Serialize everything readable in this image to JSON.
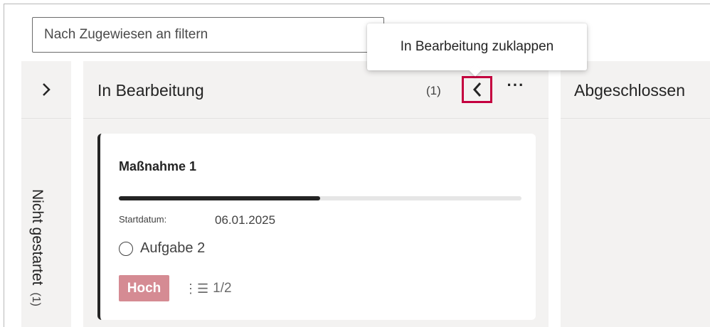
{
  "filter": {
    "placeholder": "Nach Zugewiesen an filtern",
    "chevron_icon": "chevron-down-icon"
  },
  "columns": [
    {
      "title": "Nicht gestartet",
      "count": "(1)",
      "collapsed": true,
      "expand_icon": "chevron-right-icon"
    },
    {
      "title": "In Bearbeitung",
      "count": "(1)",
      "collapsed": false,
      "collapse_icon": "chevron-left-icon",
      "more_icon": "more-horizontal-icon",
      "cards": [
        {
          "title": "Maßnahme 1",
          "progress": 0.5,
          "start_label": "Startdatum:",
          "start_date": "06.01.2025",
          "task": "Aufgabe 2",
          "priority": "Hoch",
          "priority_color": "#d58b93",
          "checklist": "1/2",
          "checklist_icon": "checklist-icon"
        }
      ]
    },
    {
      "title": "Abgeschlossen",
      "collapsed": false
    }
  ],
  "tooltip": {
    "text": "In Bearbeitung zuklappen"
  },
  "colors": {
    "column_bg": "#f3f2f1",
    "highlight": "#c4003f",
    "accent_dark": "#242424"
  }
}
